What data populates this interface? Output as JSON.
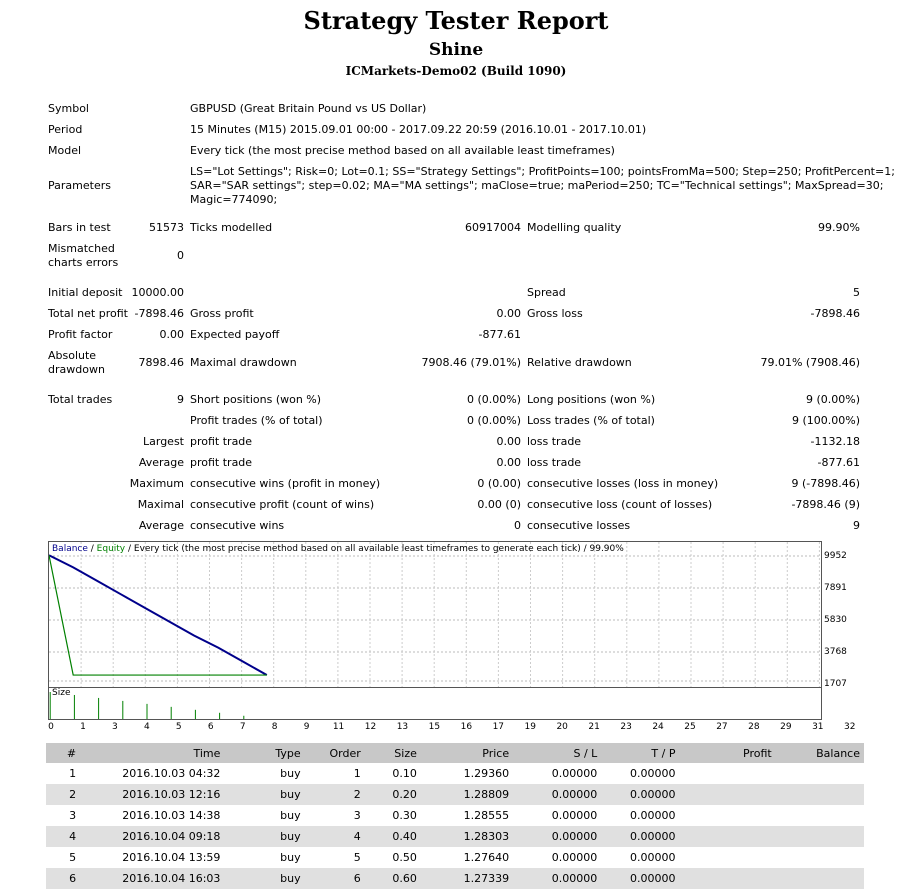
{
  "title": "Strategy Tester Report",
  "expert": "Shine",
  "server": "ICMarkets-Demo02 (Build 1090)",
  "info": {
    "symbol_label": "Symbol",
    "symbol": "GBPUSD (Great Britain Pound vs US Dollar)",
    "period_label": "Period",
    "period": "15 Minutes (M15) 2015.09.01 00:00 - 2017.09.22 20:59 (2016.10.01 - 2017.10.01)",
    "model_label": "Model",
    "model": "Every tick (the most precise method based on all available least timeframes)",
    "params_label": "Parameters",
    "params_line1": "LS=\"Lot Settings\"; Risk=0; Lot=0.1; SS=\"Strategy Settings\"; ProfitPoints=100; pointsFromMa=500; Step=250; ProfitPercent=1;",
    "params_line2": "SAR=\"SAR settings\"; step=0.02; MA=\"MA settings\"; maClose=true; maPeriod=250; TC=\"Technical settings\"; MaxSpread=30;",
    "params_line3": "Magic=774090;"
  },
  "stats": {
    "bars_label": "Bars in test",
    "bars": "51573",
    "ticks_label": "Ticks modelled",
    "ticks": "60917004",
    "quality_label": "Modelling quality",
    "quality": "99.90%",
    "mismatch_label1": "Mismatched",
    "mismatch_label2": "charts errors",
    "mismatch": "0",
    "deposit_label": "Initial deposit",
    "deposit": "10000.00",
    "spread_label": "Spread",
    "spread": "5",
    "net_label": "Total net profit",
    "net": "-7898.46",
    "gross_profit_label": "Gross profit",
    "gross_profit": "0.00",
    "gross_loss_label": "Gross loss",
    "gross_loss": "-7898.46",
    "pf_label": "Profit factor",
    "pf": "0.00",
    "exp_label": "Expected payoff",
    "exp": "-877.61",
    "abs_dd_label1": "Absolute",
    "abs_dd_label2": "drawdown",
    "abs_dd": "7898.46",
    "max_dd_label": "Maximal drawdown",
    "max_dd": "7908.46 (79.01%)",
    "rel_dd_label": "Relative drawdown",
    "rel_dd": "79.01% (7908.46)",
    "trades_label": "Total trades",
    "trades": "9",
    "short_label": "Short positions (won %)",
    "short": "0 (0.00%)",
    "long_label": "Long positions (won %)",
    "long": "9 (0.00%)",
    "ptrades_label": "Profit trades (% of total)",
    "ptrades": "0 (0.00%)",
    "ltrades_label": "Loss trades (% of total)",
    "ltrades": "9 (100.00%)",
    "largest": "Largest",
    "average": "Average",
    "maximum": "Maximum",
    "maximal": "Maximal",
    "profit_trade": "profit trade",
    "loss_trade": "loss trade",
    "largest_profit": "0.00",
    "largest_loss": "-1132.18",
    "average_profit": "0.00",
    "average_loss": "-877.61",
    "cons_wins_money_label": "consecutive wins (profit in money)",
    "cons_wins_money": "0 (0.00)",
    "cons_losses_money_label": "consecutive losses (loss in money)",
    "cons_losses_money": "9 (-7898.46)",
    "cons_profit_count_label": "consecutive profit (count of wins)",
    "cons_profit_count": "0.00 (0)",
    "cons_loss_count_label": "consecutive loss (count of losses)",
    "cons_loss_count": "-7898.46 (9)",
    "avg_cons_wins_label": "consecutive wins",
    "avg_cons_wins": "0",
    "avg_cons_losses_label": "consecutive losses",
    "avg_cons_losses": "9"
  },
  "graph": {
    "legend_balance": "Balance",
    "legend_sep1": " / ",
    "legend_equity": "Equity",
    "legend_rest": " / Every tick (the most precise method based on all available least timeframes to generate each tick) / 99.90%",
    "size_label": "Size",
    "y_labels": [
      "9952",
      "7891",
      "5830",
      "3768",
      "1707"
    ],
    "x_labels": [
      "0",
      "1",
      "3",
      "4",
      "5",
      "6",
      "7",
      "8",
      "9",
      "11",
      "12",
      "13",
      "15",
      "16",
      "17",
      "19",
      "20",
      "21",
      "23",
      "24",
      "25",
      "27",
      "28",
      "29",
      "31",
      "32"
    ],
    "balance_color": "#00008b",
    "equity_color": "#008000"
  },
  "chart_data": {
    "type": "line",
    "series": [
      {
        "name": "Balance",
        "x": [
          0,
          1,
          2,
          3,
          4,
          5,
          6,
          7,
          8,
          9
        ],
        "values": [
          10000,
          9200,
          8300,
          7400,
          6500,
          5600,
          4700,
          3900,
          3000,
          2100
        ]
      },
      {
        "name": "Equity",
        "x": [
          0,
          1,
          9
        ],
        "values": [
          10000,
          2100,
          2100
        ]
      }
    ],
    "sizes": [
      0.1,
      0.2,
      0.3,
      0.4,
      0.5,
      0.6,
      0.7,
      0.8,
      0.9
    ],
    "ylim": [
      1707,
      9952
    ],
    "xlim": [
      0,
      32
    ]
  },
  "table": {
    "headers": [
      "#",
      "Time",
      "Type",
      "Order",
      "Size",
      "Price",
      "S / L",
      "T / P",
      "Profit",
      "Balance"
    ],
    "rows": [
      [
        "1",
        "2016.10.03 04:32",
        "buy",
        "1",
        "0.10",
        "1.29360",
        "0.00000",
        "0.00000",
        "",
        ""
      ],
      [
        "2",
        "2016.10.03 12:16",
        "buy",
        "2",
        "0.20",
        "1.28809",
        "0.00000",
        "0.00000",
        "",
        ""
      ],
      [
        "3",
        "2016.10.03 14:38",
        "buy",
        "3",
        "0.30",
        "1.28555",
        "0.00000",
        "0.00000",
        "",
        ""
      ],
      [
        "4",
        "2016.10.04 09:18",
        "buy",
        "4",
        "0.40",
        "1.28303",
        "0.00000",
        "0.00000",
        "",
        ""
      ],
      [
        "5",
        "2016.10.04 13:59",
        "buy",
        "5",
        "0.50",
        "1.27640",
        "0.00000",
        "0.00000",
        "",
        ""
      ],
      [
        "6",
        "2016.10.04 16:03",
        "buy",
        "6",
        "0.60",
        "1.27339",
        "0.00000",
        "0.00000",
        "",
        ""
      ]
    ]
  }
}
